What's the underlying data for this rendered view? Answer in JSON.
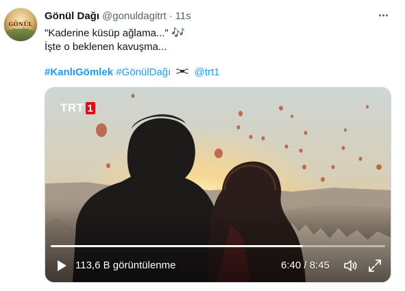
{
  "tweet": {
    "author": {
      "display_name": "Gönül Dağı",
      "handle": "@gonuldagitrt",
      "avatar_logo_text": "GÖNÜL DAĞI"
    },
    "separator": "·",
    "timestamp": "11s",
    "text_line1": "\"Kaderine küsüp ağlama...\"",
    "music_emoji": "🎶",
    "text_line2": "İşte o beklenen kavuşma...",
    "hashtags": {
      "tag1": "#KanlıGömlek",
      "tag2": "#GönülDağı",
      "mention": "@trt1"
    },
    "drone_icon": "drone-icon"
  },
  "video": {
    "channel_logo": {
      "text": "TRT",
      "number": "1"
    },
    "progress_fraction": 0.755,
    "views_label": "113,6 B görüntülenme",
    "timecode": "6:40 / 8:45",
    "icons": {
      "play": "play-icon",
      "volume": "volume-icon",
      "fullscreen": "fullscreen-icon",
      "more": "more-horizontal-icon"
    }
  },
  "colors": {
    "accent": "#1d9bf0",
    "text": "#0f1419",
    "secondary": "#536471",
    "trt_red": "#e30a17"
  }
}
